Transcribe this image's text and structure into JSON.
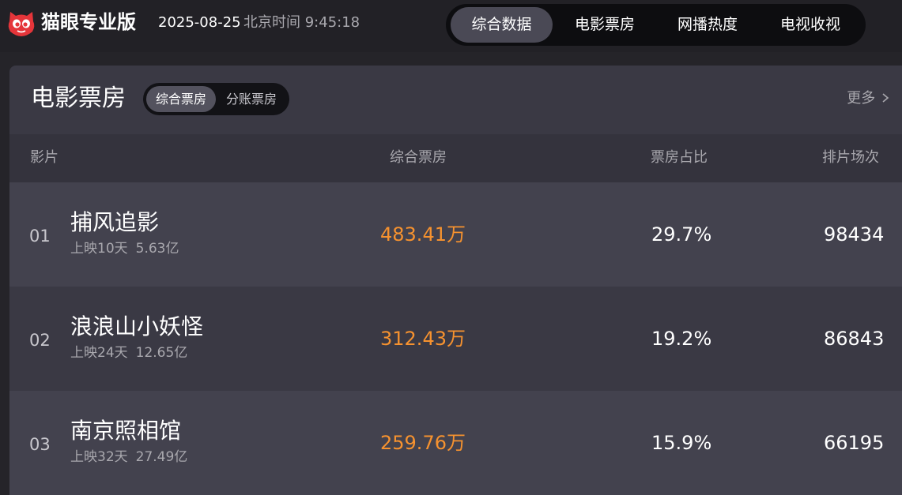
{
  "header": {
    "brand": "猫眼专业版",
    "date": "2025-08-25",
    "time": "北京时间 9:45:18",
    "tabs": [
      {
        "label": "综合数据",
        "active": true
      },
      {
        "label": "电影票房",
        "active": false
      },
      {
        "label": "网播热度",
        "active": false
      },
      {
        "label": "电视收视",
        "active": false
      }
    ]
  },
  "panel": {
    "title": "电影票房",
    "segments": [
      {
        "label": "综合票房",
        "active": true
      },
      {
        "label": "分账票房",
        "active": false
      }
    ],
    "more": "更多",
    "columns": {
      "film": "影片",
      "gross": "综合票房",
      "share": "票房占比",
      "shows": "排片场次"
    },
    "rows": [
      {
        "rank": "01",
        "name": "捕风追影",
        "days": "上映10天",
        "total": "5.63亿",
        "gross": "483.41万",
        "share": "29.7%",
        "shows": "98434"
      },
      {
        "rank": "02",
        "name": "浪浪山小妖怪",
        "days": "上映24天",
        "total": "12.65亿",
        "gross": "312.43万",
        "share": "19.2%",
        "shows": "86843"
      },
      {
        "rank": "03",
        "name": "南京照相馆",
        "days": "上映32天",
        "total": "27.49亿",
        "gross": "259.76万",
        "share": "15.9%",
        "shows": "66195"
      }
    ]
  },
  "colors": {
    "accent_orange": "#f6922f",
    "logo_red": "#e5353a",
    "panel_bg": "#3a3944",
    "row_alt_bg": "#43424e"
  }
}
